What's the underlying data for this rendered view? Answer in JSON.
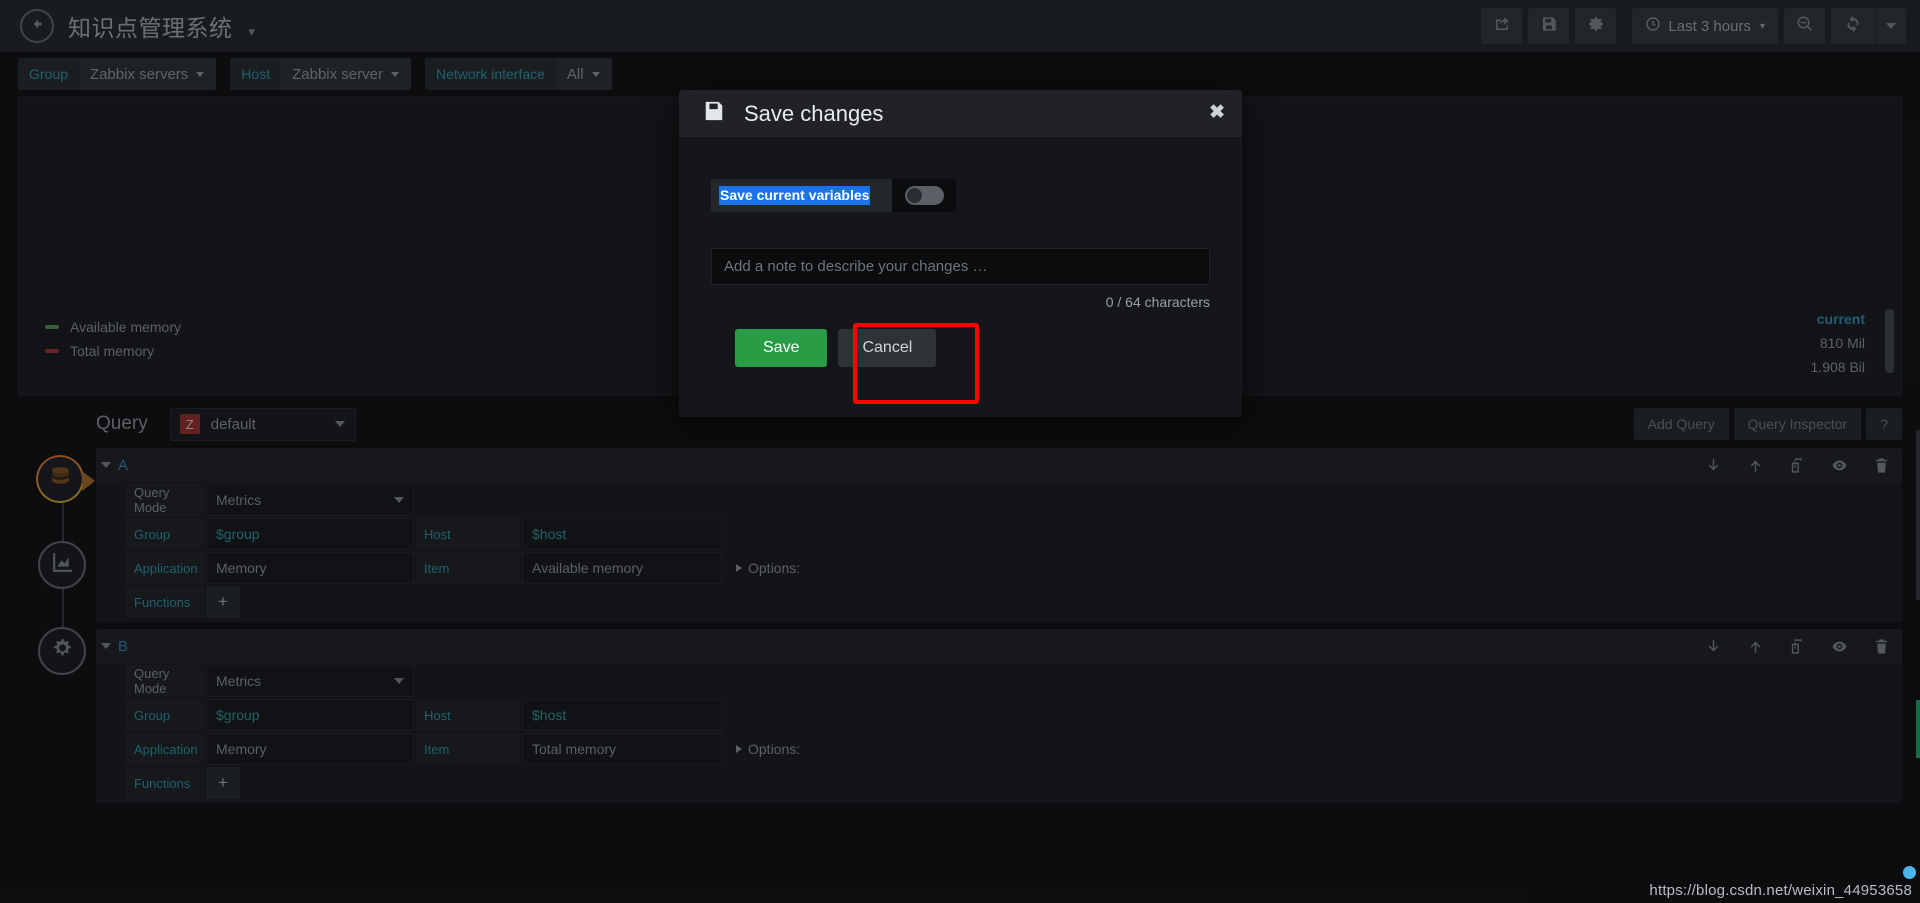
{
  "nav": {
    "back_icon": "arrow-left-circle-icon",
    "dashboard_title": "知识点管理系统",
    "title_caret": "▾",
    "icons": [
      {
        "name": "share-icon"
      },
      {
        "name": "save-dashboard-icon"
      },
      {
        "name": "dashboard-settings-gear-icon"
      }
    ],
    "time_picker": {
      "clock_icon": "clock-icon",
      "label": "Last 3 hours",
      "caret": "▾"
    },
    "zoom_out_icon": "zoom-out-magnifier-icon",
    "refresh_icon": "refresh-icon",
    "refresh_interval_caret": "▾"
  },
  "variables": [
    {
      "label": "Group",
      "value": "Zabbix servers"
    },
    {
      "label": "Host",
      "value": "Zabbix server"
    },
    {
      "label": "Network interface",
      "value": "All"
    }
  ],
  "panel": {
    "legend": [
      {
        "name": "Available memory",
        "color": "#56a64b"
      },
      {
        "name": "Total memory",
        "color": "#b5394a"
      }
    ],
    "stats_header": "current",
    "stats_values": [
      "810 Mil",
      "1.908 Bil"
    ]
  },
  "editor_rail": [
    {
      "name": "queries-tab",
      "icon": "database-icon",
      "active": true
    },
    {
      "name": "visualization-tab",
      "icon": "area-chart-icon",
      "active": false
    },
    {
      "name": "general-settings-tab",
      "icon": "gear-wrench-icon",
      "active": false
    }
  ],
  "query_editor": {
    "section_label": "Query",
    "datasource": {
      "badge": "Z",
      "name": "default"
    },
    "add_query_label": "Add Query",
    "query_inspector_label": "Query Inspector",
    "help_label": "?",
    "row_action_icons": [
      "move-down-icon",
      "move-up-icon",
      "duplicate-icon",
      "toggle-visibility-eye-icon",
      "delete-trash-icon"
    ],
    "queries": [
      {
        "ref": "A",
        "query_mode_label": "Query Mode",
        "query_mode_value": "Metrics",
        "group_label": "Group",
        "group_value": "$group",
        "host_label": "Host",
        "host_value": "$host",
        "application_label": "Application",
        "application_value": "Memory",
        "item_label": "Item",
        "item_value": "Available memory",
        "options_label": "Options:",
        "functions_label": "Functions",
        "functions_add": "+"
      },
      {
        "ref": "B",
        "query_mode_label": "Query Mode",
        "query_mode_value": "Metrics",
        "group_label": "Group",
        "group_value": "$group",
        "host_label": "Host",
        "host_value": "$host",
        "application_label": "Application",
        "application_value": "Memory",
        "item_label": "Item",
        "item_value": "Total memory",
        "options_label": "Options:",
        "functions_label": "Functions",
        "functions_add": "+"
      }
    ]
  },
  "modal": {
    "icon": "floppy-disk-icon",
    "title": "Save changes",
    "close_label": "✖",
    "save_variables_label": "Save current variables",
    "save_variables_on": false,
    "note_value": "",
    "note_placeholder": "Add a note to describe your changes …",
    "char_count": "0 / 64 characters",
    "save_label": "Save",
    "cancel_label": "Cancel",
    "save_color": "#299c46",
    "highlight_color": "#fe0000"
  },
  "watermark": "https://blog.csdn.net/weixin_44953658"
}
